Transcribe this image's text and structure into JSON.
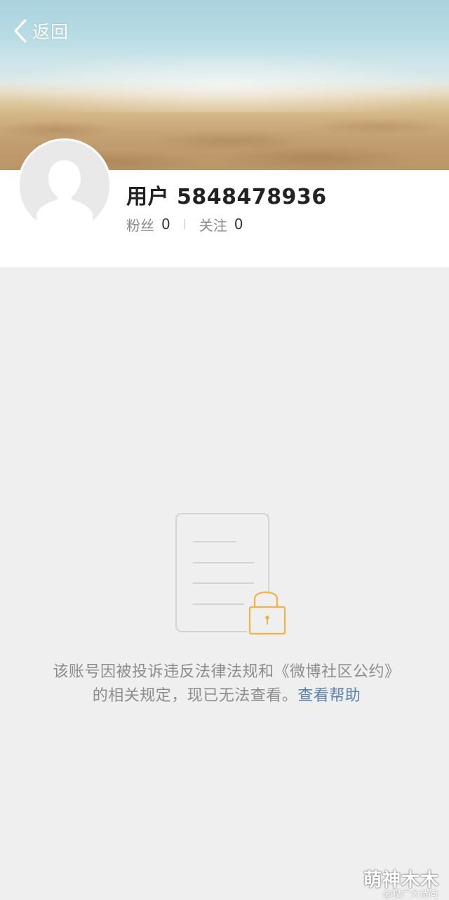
{
  "header": {
    "back_label": "返回",
    "back_icon": "chevron-left-icon"
  },
  "profile": {
    "username": "用户 5848478936",
    "followers_label": "粉丝",
    "followers_count": "0",
    "following_label": "关注",
    "following_count": "0",
    "avatar_icon": "default-avatar-icon"
  },
  "notice": {
    "icon": "locked-document-icon",
    "message": "该账号因被投诉违反法律法规和《微博社区公约》的相关规定，现已无法查看。",
    "help_link": "查看帮助"
  },
  "watermark": {
    "text": "萌神木木",
    "subtext": "@狐广大诗问"
  },
  "colors": {
    "link": "#5d82ad",
    "lock": "#f0b24a",
    "background": "#efefef"
  }
}
